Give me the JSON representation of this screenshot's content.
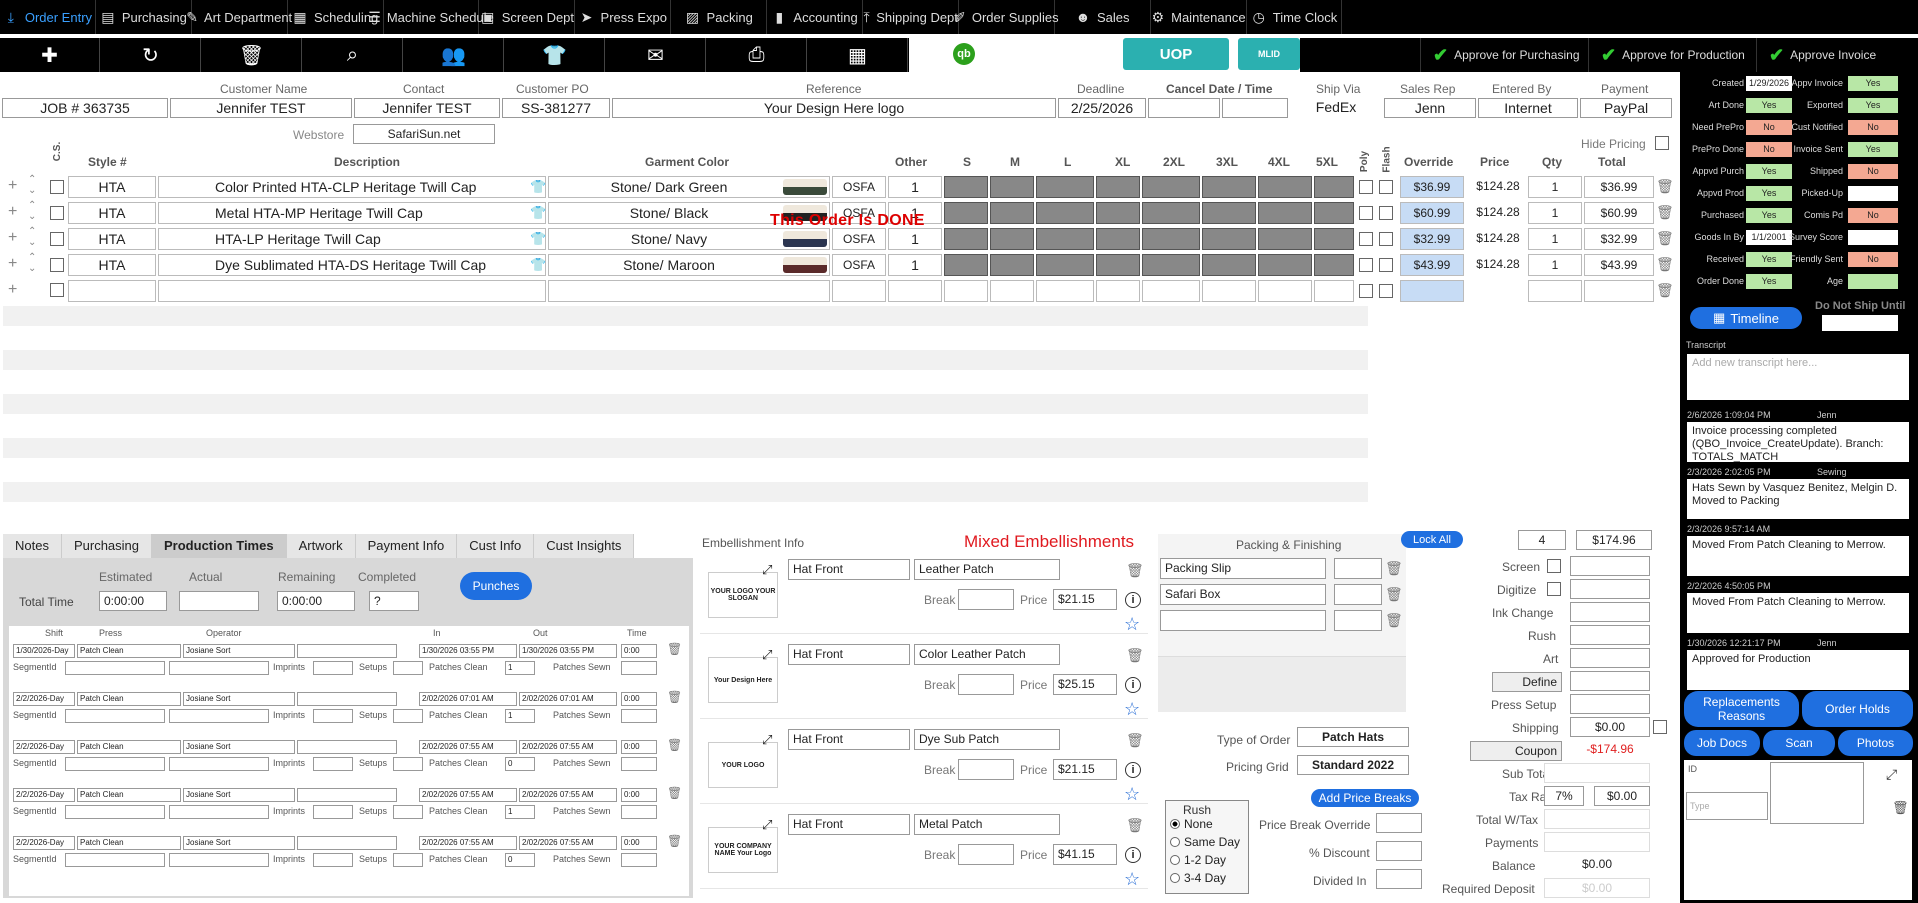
{
  "nav": [
    {
      "label": "Order Entry",
      "icon": "download-icon"
    },
    {
      "label": "Purchasing",
      "icon": "clipboard-icon"
    },
    {
      "label": "Art Department",
      "icon": "brush-icon"
    },
    {
      "label": "Scheduling",
      "icon": "calendar-grid-icon"
    },
    {
      "label": "Machine Schedule",
      "icon": "list-icon"
    },
    {
      "label": "Screen Dept",
      "icon": "screens-icon"
    },
    {
      "label": "Press Expo",
      "icon": "send-icon"
    },
    {
      "label": "Packing",
      "icon": "box-icon"
    },
    {
      "label": "Accounting",
      "icon": "bar-chart-icon"
    },
    {
      "label": "Shipping Dept",
      "icon": "upload-icon"
    },
    {
      "label": "Order Supplies",
      "icon": "edit-icon"
    },
    {
      "label": "Sales",
      "icon": "people-icon"
    },
    {
      "label": "Maintenance",
      "icon": "gear-icon"
    },
    {
      "label": "Time Clock",
      "icon": "clock-icon"
    }
  ],
  "toolbar": {
    "uop": "UOP",
    "mlid": "MLID",
    "qb": "qb",
    "approve_purchasing": "Approve for Purchasing",
    "approve_production": "Approve for Production",
    "approve_invoice": "Approve Invoice"
  },
  "header": {
    "customer_name_label": "Customer Name",
    "contact_label": "Contact",
    "customer_po_label": "Customer PO",
    "reference_label": "Reference",
    "deadline_label": "Deadline",
    "cancel_label": "Cancel Date / Time",
    "ship_via_label": "Ship Via",
    "sales_rep_label": "Sales Rep",
    "entered_by_label": "Entered By",
    "payment_label": "Payment",
    "job": "JOB # 363735",
    "customer_name": "Jennifer TEST",
    "contact": "Jennifer TEST",
    "customer_po": "SS-381277",
    "reference": "Your Design Here logo",
    "deadline": "2/25/2026",
    "ship_via": "FedEx",
    "sales_rep": "Jenn",
    "entered_by": "Internet",
    "payment": "PayPal",
    "webstore_label": "Webstore",
    "webstore": "SafariSun.net",
    "hide_pricing": "Hide Pricing"
  },
  "grid": {
    "headers": {
      "cs": "C.S.",
      "style": "Style #",
      "desc": "Description",
      "color": "Garment Color",
      "other": "Other",
      "s": "S",
      "m": "M",
      "l": "L",
      "xl": "XL",
      "xxl": "2XL",
      "xxxl": "3XL",
      "x4": "4XL",
      "x5": "5XL",
      "poly": "Poly",
      "flash": "Flash",
      "override": "Override",
      "price": "Price",
      "qty": "Qty",
      "total": "Total"
    },
    "rows": [
      {
        "style": "HTA",
        "desc": "Color Printed HTA-CLP Heritage Twill Cap",
        "color": "Stone/ Dark Green",
        "size": "OSFA",
        "other": "1",
        "override": "$36.99",
        "price": "$124.28",
        "qty": "1",
        "total": "$36.99",
        "swatch": "#3a4a3a"
      },
      {
        "style": "HTA",
        "desc": "Metal HTA-MP Heritage Twill Cap",
        "color": "Stone/ Black",
        "size": "OSFA",
        "other": "1",
        "override": "$60.99",
        "price": "$124.28",
        "qty": "1",
        "total": "$60.99",
        "swatch": "#222222"
      },
      {
        "style": "HTA",
        "desc": "HTA-LP Heritage Twill Cap",
        "color": "Stone/ Navy",
        "size": "OSFA",
        "other": "1",
        "override": "$32.99",
        "price": "$124.28",
        "qty": "1",
        "total": "$32.99",
        "swatch": "#2b3550"
      },
      {
        "style": "HTA",
        "desc": "Dye Sublimated HTA-DS Heritage Twill Cap",
        "color": "Stone/ Maroon",
        "size": "OSFA",
        "other": "1",
        "override": "$43.99",
        "price": "$124.28",
        "qty": "1",
        "total": "$43.99",
        "swatch": "#5a2a2a"
      }
    ],
    "done_banner": "This Order Is DONE"
  },
  "tabs": [
    "Notes",
    "Purchasing",
    "Production Times",
    "Artwork",
    "Payment Info",
    "Cust Info",
    "Cust Insights"
  ],
  "production": {
    "estimated_label": "Estimated",
    "actual_label": "Actual",
    "remaining_label": "Remaining",
    "completed_label": "Completed",
    "total_time_label": "Total Time",
    "estimated": "0:00:00",
    "actual": "",
    "remaining": "0:00:00",
    "completed": "?",
    "punches": "Punches",
    "col_shift": "Shift",
    "col_press": "Press",
    "col_operator": "Operator",
    "col_in": "In",
    "col_out": "Out",
    "col_time": "Time",
    "segment_label": "SegmentId",
    "imprints_label": "Imprints",
    "setups_label": "Setups",
    "patches_clean_label": "Patches Clean",
    "patches_sewn_label": "Patches Sewn",
    "entries": [
      {
        "shift": "1/30/2026-Day",
        "press": "Patch Clean",
        "operator": "Josiane Sort",
        "in": "1/30/2026 03:55 PM",
        "out": "1/30/2026 03:55 PM",
        "time": "0:00",
        "clean": "1"
      },
      {
        "shift": "2/2/2026-Day",
        "press": "Patch Clean",
        "operator": "Josiane Sort",
        "in": "2/02/2026 07:01 AM",
        "out": "2/02/2026 07:01 AM",
        "time": "0:00",
        "clean": "1"
      },
      {
        "shift": "2/2/2026-Day",
        "press": "Patch Clean",
        "operator": "Josiane Sort",
        "in": "2/02/2026 07:55 AM",
        "out": "2/02/2026 07:55 AM",
        "time": "0:00",
        "clean": "0"
      },
      {
        "shift": "2/2/2026-Day",
        "press": "Patch Clean",
        "operator": "Josiane Sort",
        "in": "2/02/2026 07:55 AM",
        "out": "2/02/2026 07:55 AM",
        "time": "0:00",
        "clean": "1"
      },
      {
        "shift": "2/2/2026-Day",
        "press": "Patch Clean",
        "operator": "Josiane Sort",
        "in": "2/02/2026 07:55 AM",
        "out": "2/02/2026 07:55 AM",
        "time": "0:00",
        "clean": "0"
      }
    ]
  },
  "embellishment": {
    "title": "Embellishment Info",
    "mixed": "Mixed Embellishments",
    "break_label": "Break",
    "price_label": "Price",
    "items": [
      {
        "location": "Hat Front",
        "type": "Leather Patch",
        "price": "$21.15",
        "thumb": "YOUR LOGO YOUR SLOGAN"
      },
      {
        "location": "Hat Front",
        "type": "Color Leather Patch",
        "price": "$25.15",
        "thumb": "Your Design Here"
      },
      {
        "location": "Hat Front",
        "type": "Dye Sub Patch",
        "price": "$21.15",
        "thumb": "YOUR LOGO"
      },
      {
        "location": "Hat Front",
        "type": "Metal Patch",
        "price": "$41.15",
        "thumb": "YOUR COMPANY NAME Your Logo"
      }
    ]
  },
  "packing": {
    "title": "Packing & Finishing",
    "items": [
      "Packing Slip",
      "Safari Box",
      ""
    ],
    "lock_all": "Lock All",
    "type_label": "Type of Order",
    "type": "Patch Hats",
    "grid_label": "Pricing Grid",
    "grid": "Standard 2022",
    "add_breaks": "Add Price Breaks",
    "rush_label": "Rush",
    "rush_options": [
      "None",
      "Same Day",
      "1-2 Day",
      "3-4 Day"
    ],
    "rush_selected": "None",
    "pbo_label": "Price Break Override",
    "disc_label": "% Discount",
    "div_label": "Divided In"
  },
  "totals": {
    "qty": "4",
    "amount": "$174.96",
    "screen": "Screen",
    "digitize": "Digitize",
    "ink": "Ink Change",
    "rush": "Rush",
    "art": "Art",
    "define": "Define",
    "press_setup": "Press Setup",
    "shipping_label": "Shipping",
    "shipping": "$0.00",
    "coupon_label": "Coupon",
    "coupon": "-$174.96",
    "subtotal": "Sub Total",
    "tax_label": "Tax Rate",
    "tax_rate": "7%",
    "tax": "$0.00",
    "total_wtax": "Total W/Tax",
    "payments": "Payments",
    "balance_label": "Balance",
    "balance": "$0.00",
    "deposit_label": "Required Deposit",
    "deposit": "$0.00"
  },
  "status": {
    "left": [
      {
        "label": "Created",
        "value": "1/29/2026",
        "kind": "white"
      },
      {
        "label": "Art Done",
        "value": "Yes",
        "kind": "yes"
      },
      {
        "label": "Need PrePro",
        "value": "No",
        "kind": "no"
      },
      {
        "label": "PrePro Done",
        "value": "No",
        "kind": "no"
      },
      {
        "label": "Appvd Purch",
        "value": "Yes",
        "kind": "yes"
      },
      {
        "label": "Appvd Prod",
        "value": "Yes",
        "kind": "yes"
      },
      {
        "label": "Purchased",
        "value": "Yes",
        "kind": "yes"
      },
      {
        "label": "Goods In By",
        "value": "1/1/2001",
        "kind": "white"
      },
      {
        "label": "Received",
        "value": "Yes",
        "kind": "yes"
      },
      {
        "label": "Order Done",
        "value": "Yes",
        "kind": "yes"
      }
    ],
    "right": [
      {
        "label": "Appv Invoice",
        "value": "Yes",
        "kind": "yes"
      },
      {
        "label": "Exported",
        "value": "Yes",
        "kind": "yes"
      },
      {
        "label": "Cust Notified",
        "value": "No",
        "kind": "no"
      },
      {
        "label": "Invoice Sent",
        "value": "Yes",
        "kind": "yes"
      },
      {
        "label": "Shipped",
        "value": "No",
        "kind": "no"
      },
      {
        "label": "Picked-Up",
        "value": "",
        "kind": "white"
      },
      {
        "label": "Comis Pd",
        "value": "No",
        "kind": "no"
      },
      {
        "label": "Survey Score",
        "value": "",
        "kind": "white"
      },
      {
        "label": "Friendly Sent",
        "value": "No",
        "kind": "no"
      },
      {
        "label": "Age",
        "value": "",
        "kind": "yes"
      }
    ],
    "timeline": "Timeline",
    "do_not_ship": "Do Not Ship Until",
    "transcript_label": "Transcript",
    "transcript_placeholder": "Add new transcript here...",
    "notes": [
      {
        "date": "2/6/2026 1:09:04 PM",
        "user": "Jenn",
        "text": "Invoice processing completed (QBO_Invoice_CreateUpdate). Branch: TOTALS_MATCH"
      },
      {
        "date": "2/3/2026 2:02:05 PM",
        "user": "Sewing",
        "text": "Hats Sewn by Vasquez Benitez, Melgin D. Moved to Packing"
      },
      {
        "date": "2/3/2026 9:57:14 AM",
        "user": "",
        "text": "Moved From Patch Cleaning to Merrow."
      },
      {
        "date": "2/2/2026 4:50:05 PM",
        "user": "",
        "text": "Moved From Patch Cleaning to Merrow."
      },
      {
        "date": "1/30/2026 12:21:17 PM",
        "user": "Jenn",
        "text": "Approved for Production"
      }
    ],
    "replacements": "Replacements Reasons",
    "order_holds": "Order Holds",
    "job_docs": "Job Docs",
    "scan": "Scan",
    "photos": "Photos",
    "id_label": "ID",
    "type_placeholder": "Type"
  }
}
